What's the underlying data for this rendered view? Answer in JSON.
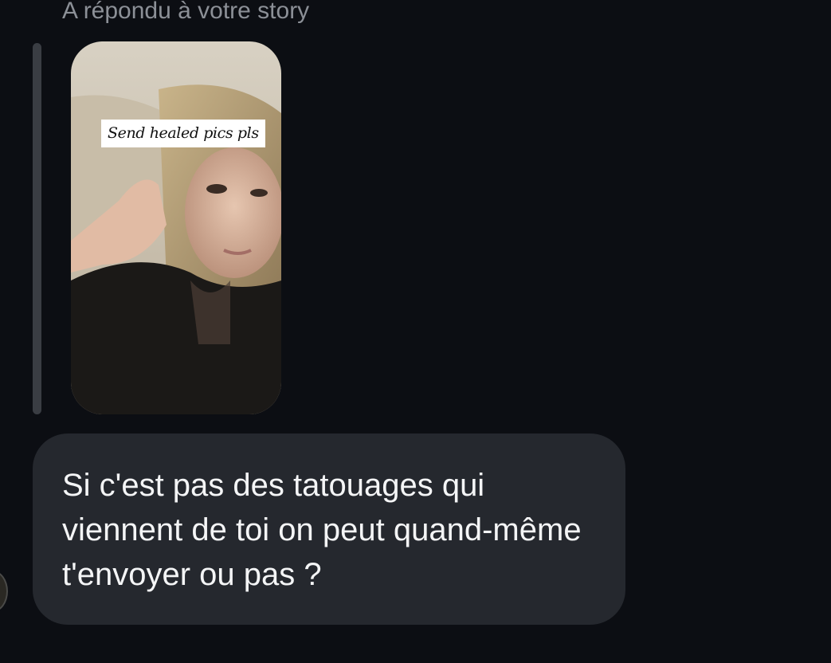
{
  "conversation": {
    "reply_header": "A répondu à votre story",
    "story": {
      "caption": "Send healed pics pls",
      "thumbnail_icon": "story-photo"
    },
    "message": {
      "text": "Si c'est pas des tatouages qui viennent de toi on peut quand-même t'envoyer ou pas ?"
    }
  },
  "colors": {
    "background": "#0c0e13",
    "bubble": "#25282e",
    "header_text": "#8c9097",
    "message_text": "#f4f5f6"
  }
}
